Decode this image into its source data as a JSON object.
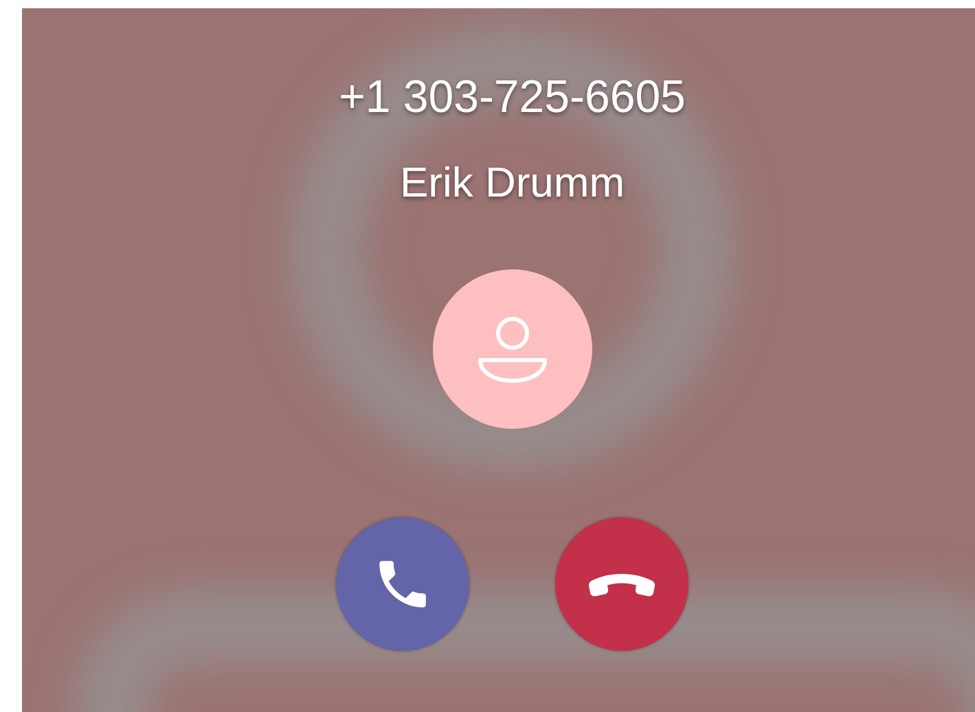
{
  "call": {
    "number": "+1 303-725-6605",
    "name": "Erik Drumm"
  },
  "actions": [
    {
      "kind": "accept"
    },
    {
      "kind": "decline"
    }
  ]
}
